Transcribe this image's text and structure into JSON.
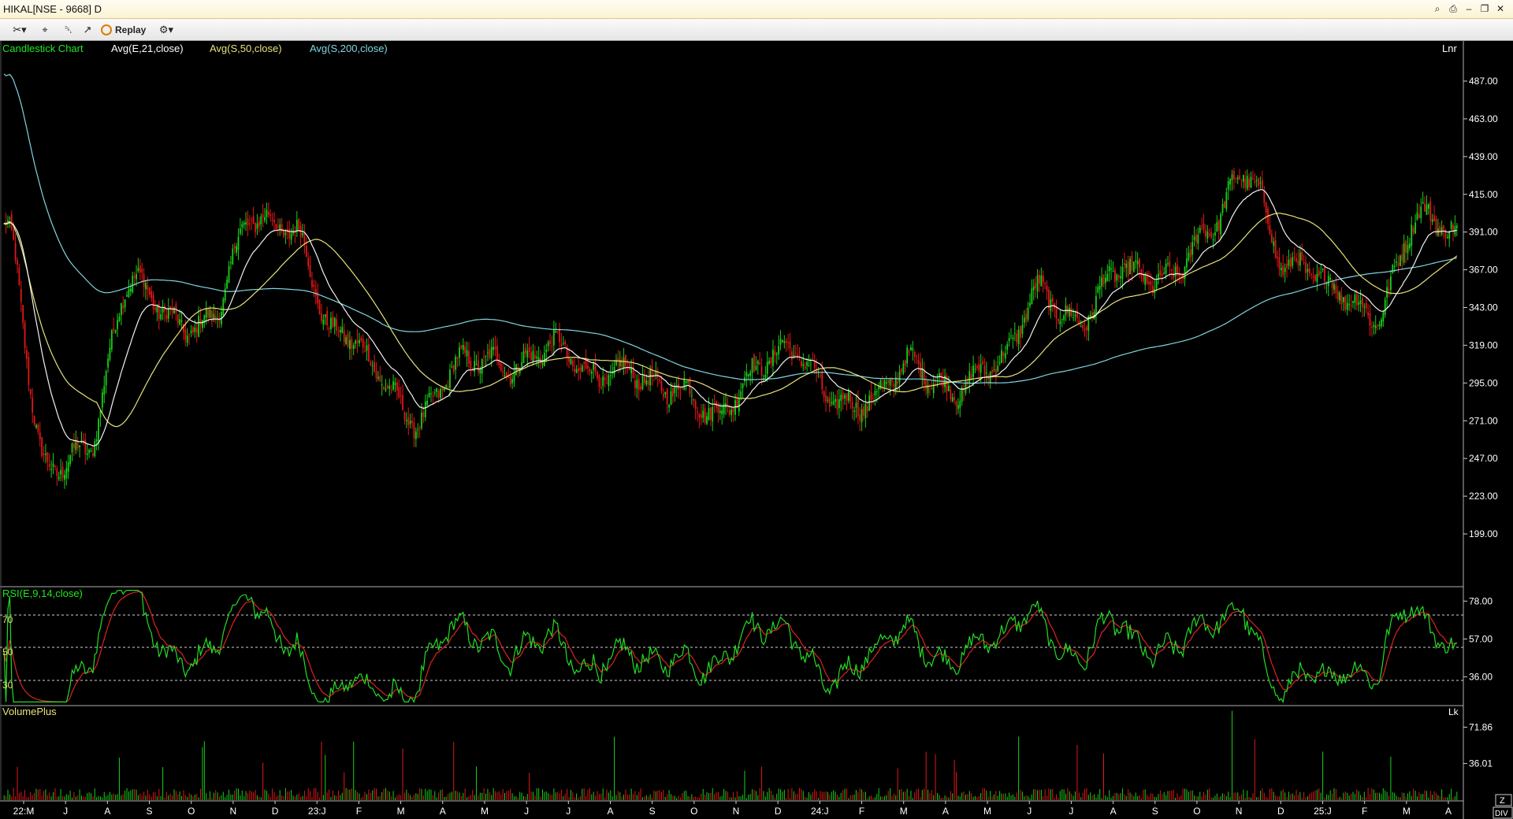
{
  "window": {
    "title": "HIKAL[NSE - 9668] D"
  },
  "toolbar": {
    "replay_label": "Replay",
    "icons": [
      "draw-tools-icon",
      "crosshair-icon",
      "delete-icon",
      "indicator-chart-icon",
      "replay-icon",
      "settings-gear-icon"
    ]
  },
  "colors": {
    "background": "#000000",
    "candle_up": "#19d019",
    "candle_down": "#e01818",
    "ema21": "#f2f2f2",
    "sma50": "#e8e27a",
    "sma200": "#7fd6e0",
    "rsi_line": "#22dd22",
    "rsi_signal": "#dd2222",
    "volume": "#19d019",
    "label_green": "#1ee81e",
    "label_yellow": "#e8e27a",
    "label_cyan": "#7fd6e0",
    "axis_text": "#ffffff"
  },
  "price_panel": {
    "chart_label": "Candlestick Chart",
    "overlays": [
      "Avg(E,21,close)",
      "Avg(S,50,close)",
      "Avg(S,200,close)"
    ],
    "scale_mode": "Lnr"
  },
  "rsi_panel": {
    "label": "RSI(E,9,14,close)",
    "level_labels": [
      "70",
      "50",
      "30"
    ]
  },
  "volume_panel": {
    "label": "VolumePlus",
    "unit": "Lk"
  },
  "corner": {
    "zoom": "Z",
    "divider": "DIV"
  },
  "chart_data": [
    {
      "type": "candlestick",
      "ylim": [
        199,
        487
      ],
      "y_ticks": [
        "487.00",
        "463.00",
        "439.00",
        "415.00",
        "391.00",
        "367.00",
        "343.00",
        "319.00",
        "295.00",
        "271.00",
        "247.00",
        "223.00",
        "199.00"
      ],
      "x_ticks": [
        "22:M",
        "J",
        "A",
        "S",
        "O",
        "N",
        "D",
        "23:J",
        "F",
        "M",
        "A",
        "M",
        "J",
        "J",
        "A",
        "S",
        "O",
        "N",
        "D",
        "24:J",
        "F",
        "M",
        "A",
        "M",
        "J",
        "J",
        "A",
        "S",
        "O",
        "N",
        "D",
        "25:J",
        "F",
        "M",
        "A"
      ],
      "close_by_month": [
        {
          "month": "22:M",
          "close": 395
        },
        {
          "month": "J",
          "close": 236
        },
        {
          "month": "A",
          "close": 262
        },
        {
          "month": "S",
          "close": 352
        },
        {
          "month": "O",
          "close": 338
        },
        {
          "month": "N",
          "close": 340
        },
        {
          "month": "D",
          "close": 392
        },
        {
          "month": "23:J",
          "close": 400
        },
        {
          "month": "F",
          "close": 322
        },
        {
          "month": "M",
          "close": 300
        },
        {
          "month": "A",
          "close": 278
        },
        {
          "month": "M",
          "close": 300
        },
        {
          "month": "J",
          "close": 312
        },
        {
          "month": "J",
          "close": 318
        },
        {
          "month": "A",
          "close": 296
        },
        {
          "month": "S",
          "close": 312
        },
        {
          "month": "O",
          "close": 284
        },
        {
          "month": "N",
          "close": 278
        },
        {
          "month": "D",
          "close": 305
        },
        {
          "month": "24:J",
          "close": 308
        },
        {
          "month": "F",
          "close": 292
        },
        {
          "month": "M",
          "close": 282
        },
        {
          "month": "A",
          "close": 305
        },
        {
          "month": "M",
          "close": 298
        },
        {
          "month": "J",
          "close": 300
        },
        {
          "month": "J",
          "close": 360
        },
        {
          "month": "A",
          "close": 335
        },
        {
          "month": "S",
          "close": 362
        },
        {
          "month": "O",
          "close": 370
        },
        {
          "month": "N",
          "close": 384
        },
        {
          "month": "D",
          "close": 430
        },
        {
          "month": "25:J",
          "close": 372
        },
        {
          "month": "F",
          "close": 348
        },
        {
          "month": "M",
          "close": 345
        },
        {
          "month": "A",
          "close": 395
        },
        {
          "month": "A",
          "close": 385
        }
      ],
      "series": [
        {
          "name": "Avg(E,21,close)"
        },
        {
          "name": "Avg(S,50,close)"
        },
        {
          "name": "Avg(S,200,close)"
        }
      ]
    },
    {
      "type": "line",
      "ylim": [
        20,
        86
      ],
      "y_ticks": [
        "78.00",
        "57.00",
        "36.00"
      ],
      "levels": [
        70,
        50,
        30
      ],
      "series": [
        {
          "name": "RSI(E,9,14,close)"
        }
      ]
    },
    {
      "type": "bar",
      "ylim": [
        0,
        90
      ],
      "y_ticks": [
        "71.86",
        "36.01"
      ],
      "series": [
        {
          "name": "VolumePlus"
        }
      ]
    }
  ]
}
